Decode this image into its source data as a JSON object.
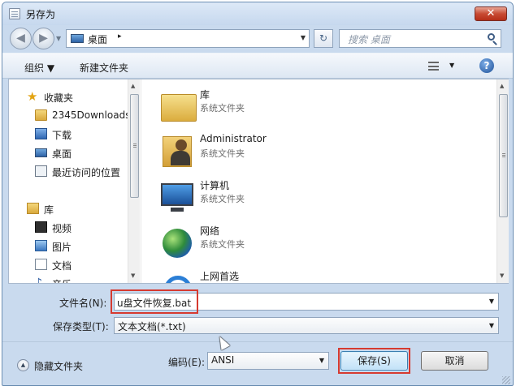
{
  "window": {
    "title": "另存为",
    "close_glyph": "✕"
  },
  "address": {
    "location": "桌面",
    "chevron": "▸",
    "search_placeholder": "搜索 桌面"
  },
  "toolbar": {
    "organize": "组织 ▼",
    "new_folder": "新建文件夹"
  },
  "sidebar": {
    "items": [
      {
        "label": "收藏夹",
        "icon": "star-icon"
      },
      {
        "label": "2345Downloads",
        "icon": "folder-icon"
      },
      {
        "label": "下载",
        "icon": "downloads-folder-icon"
      },
      {
        "label": "桌面",
        "icon": "desktop-icon"
      },
      {
        "label": "最近访问的位置",
        "icon": "recent-places-icon"
      },
      {
        "label": "库",
        "icon": "libraries-icon"
      },
      {
        "label": "视频",
        "icon": "video-icon"
      },
      {
        "label": "图片",
        "icon": "pictures-icon"
      },
      {
        "label": "文档",
        "icon": "documents-icon"
      },
      {
        "label": "音乐",
        "icon": "music-icon"
      }
    ]
  },
  "files": [
    {
      "name": "库",
      "type": "系统文件夹",
      "icon": "library-folder-icon"
    },
    {
      "name": "Administrator",
      "type": "系统文件夹",
      "icon": "user-folder-icon"
    },
    {
      "name": "计算机",
      "type": "系统文件夹",
      "icon": "computer-icon"
    },
    {
      "name": "网络",
      "type": "系统文件夹",
      "icon": "network-icon"
    },
    {
      "name": "上网首选",
      "type": "",
      "icon": "internet-explorer-icon"
    }
  ],
  "form": {
    "filename_label": "文件名(N):",
    "filename_value": "u盘文件恢复.bat",
    "filetype_label": "保存类型(T):",
    "filetype_value": "文本文档(*.txt)",
    "hide_folders": "隐藏文件夹",
    "encoding_label": "编码(E):",
    "encoding_value": "ANSI",
    "save": "保存(S)",
    "cancel": "取消"
  },
  "colors": {
    "highlight": "#d63a30",
    "close": "#c84a33",
    "accent": "#2d62a6"
  }
}
